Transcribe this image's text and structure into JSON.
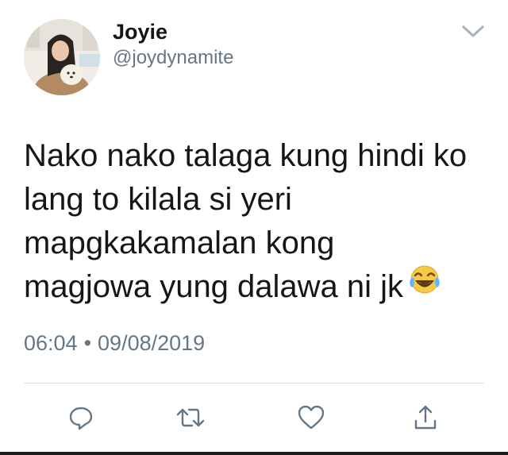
{
  "user": {
    "display_name": "Joyie",
    "handle": "@joydynamite",
    "avatar_icon": "profile-photo"
  },
  "header": {
    "more_icon": "chevron-down-icon"
  },
  "tweet": {
    "lines": [
      "Nako nako talaga kung hindi ko",
      "lang to kilala si yeri",
      "mapgkakamalan kong",
      "magjowa yung dalawa ni jk"
    ],
    "emoji": "face-with-tears-of-joy"
  },
  "meta": {
    "time": "06:04",
    "separator": "•",
    "date": "09/08/2019"
  },
  "actions": {
    "reply_icon": "reply-icon",
    "retweet_icon": "retweet-icon",
    "like_icon": "heart-icon",
    "share_icon": "share-icon"
  },
  "colors": {
    "text": "#14171a",
    "secondary": "#657786",
    "divider": "#d9dee2"
  }
}
